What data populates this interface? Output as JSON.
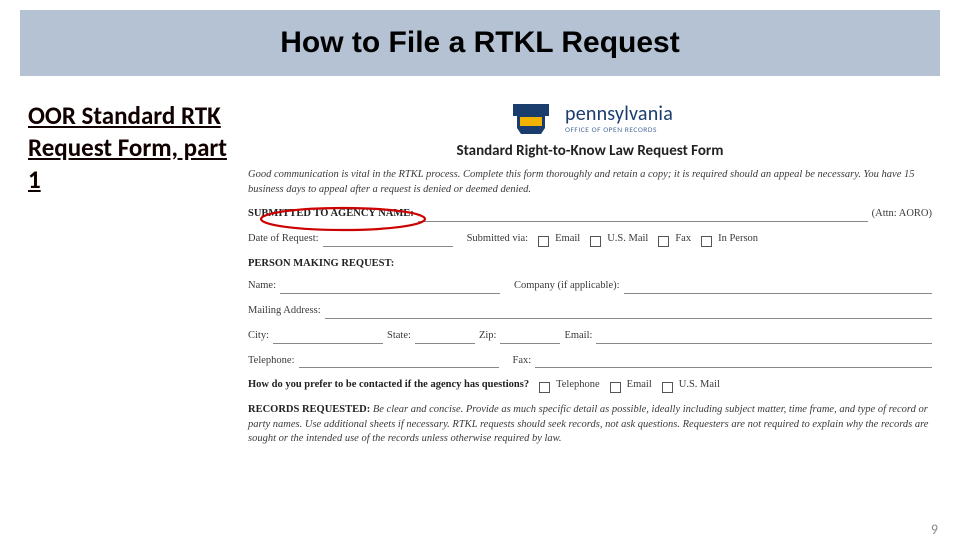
{
  "slide": {
    "title": "How to File a RTKL Request",
    "left_heading": "OOR Standard RTK Request Form, part 1",
    "page_number": "9"
  },
  "form": {
    "brand_main": "pennsylvania",
    "brand_sub": "OFFICE OF OPEN RECORDS",
    "title": "Standard Right-to-Know Law Request Form",
    "intro": "Good communication is vital in the RTKL process. Complete this form thoroughly and retain a copy; it is required should an appeal be necessary. You have 15 business days to appeal after a request is denied or deemed denied.",
    "submitted_to_label": "SUBMITTED TO AGENCY NAME:",
    "attn": "(Attn: AORO)",
    "date_label": "Date of Request:",
    "submitted_via_label": "Submitted via:",
    "via_email": "Email",
    "via_mail": "U.S. Mail",
    "via_fax": "Fax",
    "via_person": "In Person",
    "person_header": "PERSON MAKING REQUEST:",
    "name_label": "Name:",
    "company_label": "Company (if applicable):",
    "mailing_label": "Mailing Address:",
    "city_label": "City:",
    "state_label": "State:",
    "zip_label": "Zip:",
    "email_label": "Email:",
    "tel_label": "Telephone:",
    "fax_label": "Fax:",
    "contact_pref_label": "How do you prefer to be contacted if the agency has questions?",
    "pref_tel": "Telephone",
    "pref_email": "Email",
    "pref_mail": "U.S. Mail",
    "records_lead": "RECORDS REQUESTED:",
    "records_body": "Be clear and concise. Provide as much specific detail as possible, ideally including subject matter, time frame, and type of record or party names. Use additional sheets if necessary. RTKL requests should seek records, not ask questions. Requesters are not required to explain why the records are sought or the intended use of the records unless otherwise required by law."
  }
}
